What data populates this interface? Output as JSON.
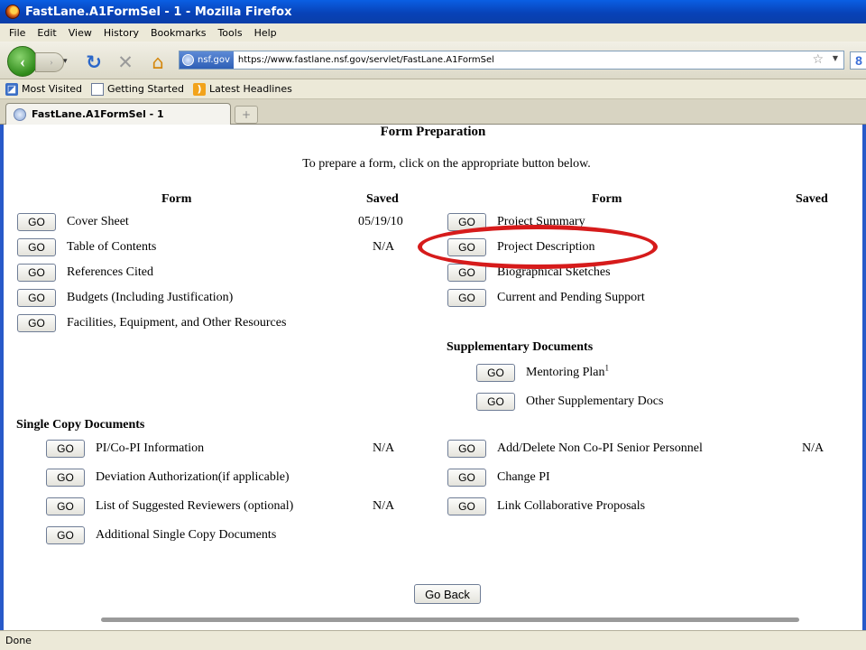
{
  "window": {
    "title": "FastLane.A1FormSel - 1 - Mozilla Firefox"
  },
  "menu": [
    "File",
    "Edit",
    "View",
    "History",
    "Bookmarks",
    "Tools",
    "Help"
  ],
  "nav": {
    "back": "‹",
    "forward": "›",
    "site_badge": "nsf.gov",
    "url": "https://www.fastlane.nsf.gov/servlet/FastLane.A1FormSel",
    "search_icon_letter": "8"
  },
  "bookmarks": [
    "Most Visited",
    "Getting Started",
    "Latest Headlines"
  ],
  "tab": {
    "label": "FastLane.A1FormSel - 1",
    "new_tab": "+"
  },
  "page": {
    "title": "Form Preparation",
    "intro": "To prepare a form, click on the appropriate button below.",
    "headers": {
      "form_left": "Form",
      "saved_left": "Saved",
      "form_right": "Form",
      "saved_right": "Saved"
    },
    "go_label": "GO",
    "left_forms": [
      {
        "label": "Cover Sheet",
        "saved": "05/19/10"
      },
      {
        "label": "Table of Contents",
        "saved": "N/A"
      },
      {
        "label": "References Cited",
        "saved": ""
      },
      {
        "label": "Budgets (Including Justification)",
        "saved": ""
      },
      {
        "label": "Facilities, Equipment, and Other Resources",
        "saved": ""
      }
    ],
    "right_forms": [
      {
        "label": "Project Summary",
        "saved": ""
      },
      {
        "label": "Project Description",
        "saved": ""
      },
      {
        "label": "Biographical Sketches",
        "saved": ""
      },
      {
        "label": "Current and Pending Support",
        "saved": ""
      }
    ],
    "supplementary": {
      "heading": "Supplementary Documents",
      "items": [
        {
          "label": "Mentoring Plan",
          "superscript": "1"
        },
        {
          "label": "Other Supplementary Docs",
          "superscript": ""
        }
      ]
    },
    "single_copy": {
      "heading": "Single Copy Documents",
      "left": [
        {
          "label": "PI/Co-PI Information",
          "saved": "N/A"
        },
        {
          "label": "Deviation Authorization(if applicable)",
          "saved": ""
        },
        {
          "label": "List of Suggested Reviewers (optional)",
          "saved": "N/A"
        },
        {
          "label": "Additional Single Copy Documents",
          "saved": ""
        }
      ],
      "right": [
        {
          "label": "Add/Delete Non Co-PI Senior Personnel",
          "saved": "N/A"
        },
        {
          "label": "Change PI",
          "saved": ""
        },
        {
          "label": "Link Collaborative Proposals",
          "saved": ""
        }
      ]
    },
    "go_back_label": "Go Back",
    "highlight_color": "#d61b1b"
  },
  "status": {
    "text": "Done"
  }
}
